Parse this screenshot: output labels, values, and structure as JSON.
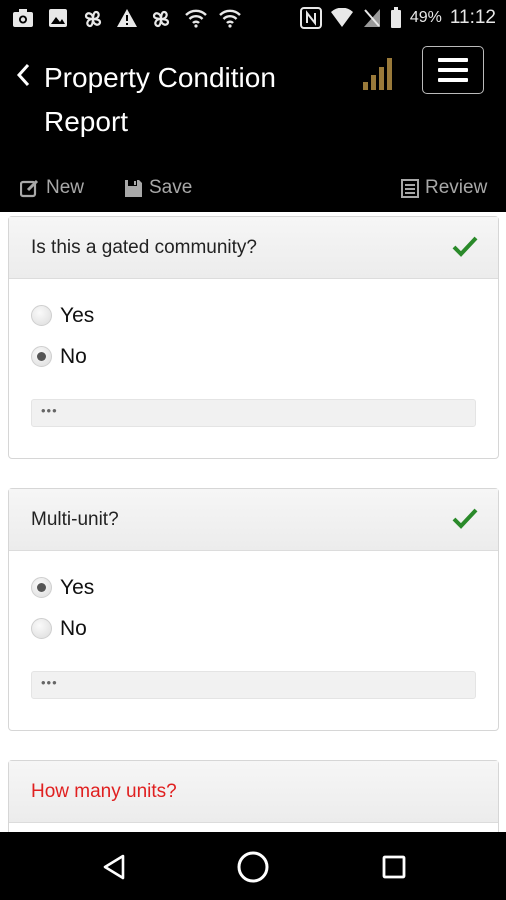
{
  "status_bar": {
    "battery_percent": "49%",
    "time": "11:12",
    "icons": [
      "camera-icon",
      "image-icon",
      "pinwheel-icon",
      "warning-icon",
      "pinwheel-icon",
      "wifi-icon",
      "wifi-icon",
      "nfc-icon",
      "wifi-signal-icon",
      "no-sim-icon",
      "battery-icon"
    ]
  },
  "header": {
    "title": "Property Condition Report",
    "back_icon": "chevron-left-icon",
    "signal_icon": "signal-bars-icon",
    "menu_icon": "hamburger-icon",
    "accent_color": "#9a7a3a"
  },
  "toolbar": {
    "new_label": "New",
    "save_label": "Save",
    "review_label": "Review"
  },
  "questions": [
    {
      "label": "Is this a gated community?",
      "answered": true,
      "options": [
        {
          "label": "Yes",
          "selected": false
        },
        {
          "label": "No",
          "selected": true
        }
      ],
      "comment": "•••"
    },
    {
      "label": "Multi-unit?",
      "answered": true,
      "options": [
        {
          "label": "Yes",
          "selected": true
        },
        {
          "label": "No",
          "selected": false
        }
      ],
      "comment": "•••"
    },
    {
      "label": "How many units?",
      "answered": false,
      "required_color": "#e02020"
    }
  ],
  "nav": {
    "back_icon": "triangle-back-icon",
    "home_icon": "circle-home-icon",
    "recents_icon": "square-recents-icon"
  }
}
